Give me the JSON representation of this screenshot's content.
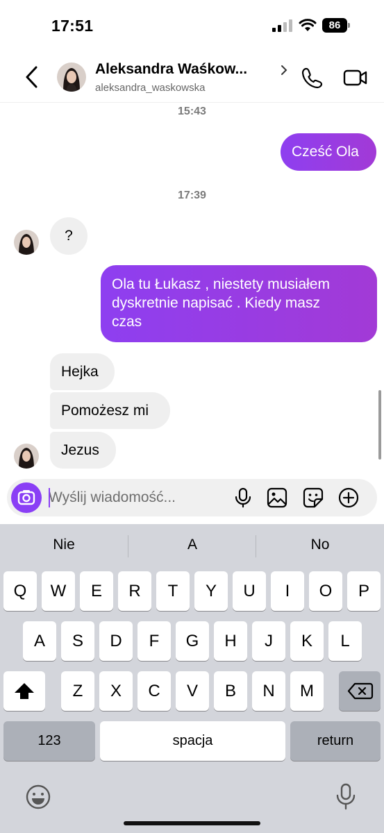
{
  "status": {
    "time": "17:51",
    "battery": "86"
  },
  "header": {
    "name": "Aleksandra Waśkow...",
    "handle": "aleksandra_waskowska"
  },
  "chat": {
    "timestamps": [
      "15:43",
      "17:39"
    ],
    "messages": [
      {
        "from": "me",
        "text": "Cześć Ola"
      },
      {
        "from": "them",
        "text": "?"
      },
      {
        "from": "me",
        "lines": [
          "Ola tu Łukasz , niestety musiałem",
          "dyskretnie napisać . Kiedy masz",
          "czas"
        ]
      },
      {
        "from": "them",
        "text": "Hejka"
      },
      {
        "from": "them",
        "text": "Pomożesz mi"
      },
      {
        "from": "them",
        "text": "Jezus"
      }
    ]
  },
  "composer": {
    "placeholder": "Wyślij wiadomość..."
  },
  "keyboard": {
    "suggestions": [
      "Nie",
      "A",
      "No"
    ],
    "row1": [
      "Q",
      "W",
      "E",
      "R",
      "T",
      "Y",
      "U",
      "I",
      "O",
      "P"
    ],
    "row2": [
      "A",
      "S",
      "D",
      "F",
      "G",
      "H",
      "J",
      "K",
      "L"
    ],
    "row3": [
      "Z",
      "X",
      "C",
      "V",
      "B",
      "N",
      "M"
    ],
    "numbers_label": "123",
    "space_label": "spacja",
    "return_label": "return"
  },
  "colors": {
    "accent": "#8a3ff5",
    "incoming_bubble": "#efefef"
  },
  "icons": [
    "back-arrow",
    "chevron-right",
    "phone",
    "video-camera",
    "camera",
    "microphone",
    "image",
    "sticker",
    "plus",
    "shift",
    "backspace",
    "emoji",
    "dictation-mic"
  ]
}
